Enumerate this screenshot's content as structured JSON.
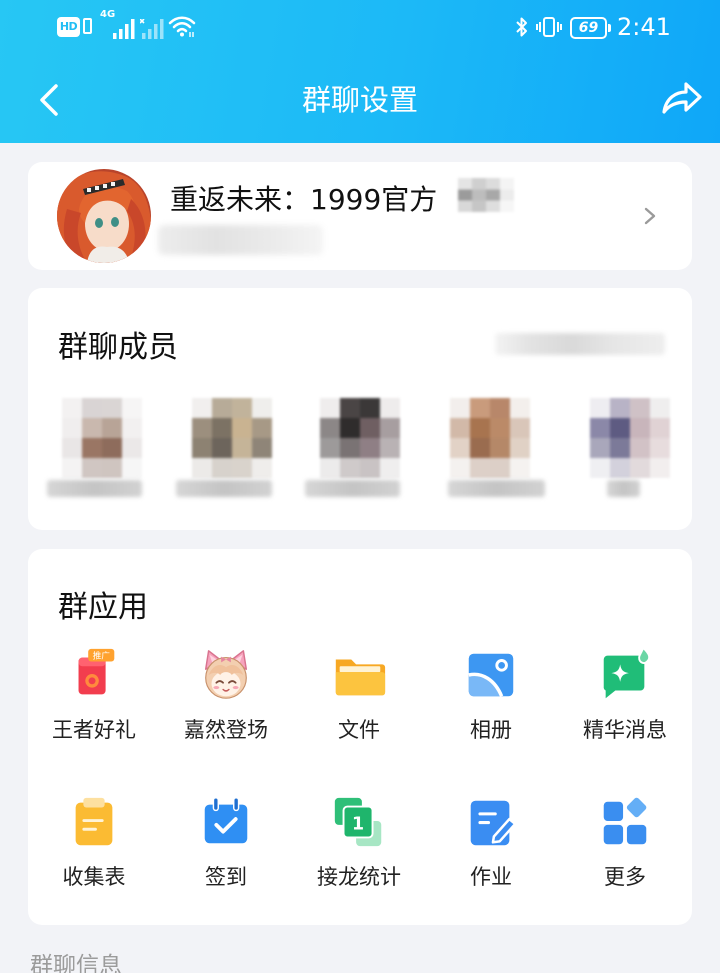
{
  "status_bar": {
    "hd": "HD",
    "network": "4G",
    "battery": "69",
    "time": "2:41"
  },
  "header": {
    "title": "群聊设置"
  },
  "group": {
    "name": "重返未来：1999官方"
  },
  "members_section": {
    "title": "群聊成员"
  },
  "apps_section": {
    "title": "群应用",
    "items": [
      {
        "label": "王者好礼",
        "icon": "gift-promo-icon",
        "badge": "推广"
      },
      {
        "label": "嘉然登场",
        "icon": "character-avatar-icon"
      },
      {
        "label": "文件",
        "icon": "folder-icon"
      },
      {
        "label": "相册",
        "icon": "album-icon"
      },
      {
        "label": "精华消息",
        "icon": "highlight-message-icon"
      },
      {
        "label": "收集表",
        "icon": "form-collect-icon"
      },
      {
        "label": "签到",
        "icon": "check-in-icon"
      },
      {
        "label": "接龙统计",
        "icon": "relay-stats-icon",
        "icon_text": "1"
      },
      {
        "label": "作业",
        "icon": "homework-icon"
      },
      {
        "label": "更多",
        "icon": "more-apps-icon"
      }
    ]
  },
  "info_section": {
    "title": "群聊信息"
  },
  "colors": {
    "header_start": "#27c7f4",
    "header_end": "#0fa7f8",
    "page_bg": "#f2f3f7",
    "card_bg": "#ffffff"
  }
}
